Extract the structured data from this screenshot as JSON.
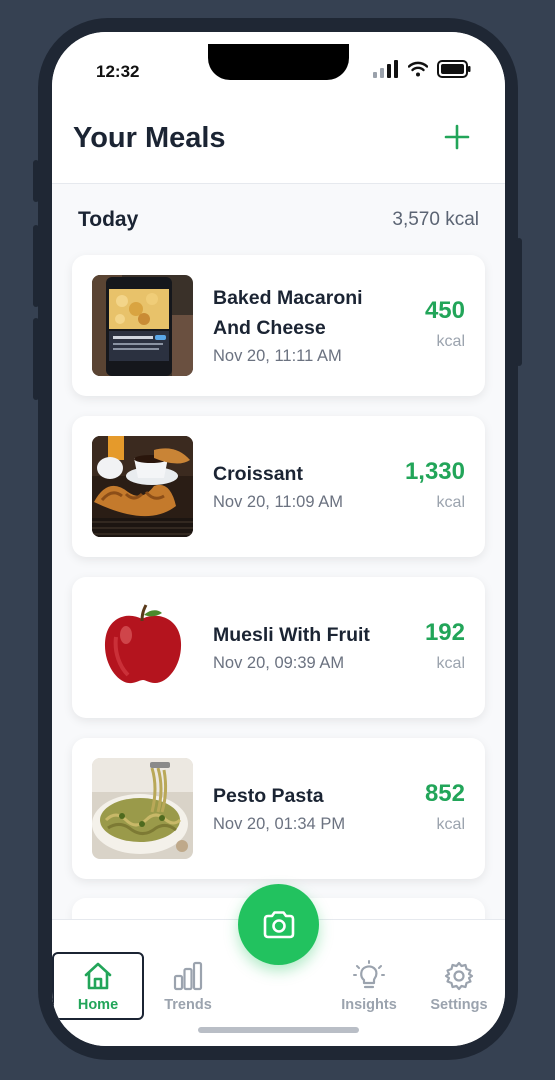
{
  "status_bar": {
    "time": "12:32"
  },
  "header": {
    "title": "Your Meals"
  },
  "section": {
    "title": "Today",
    "total": "3,570 kcal"
  },
  "meals": [
    {
      "name": "Baked Macaroni And Cheese",
      "time": "Nov 20, 11:11 AM",
      "kcal": "450",
      "unit": "kcal",
      "image": "macaroni-photo"
    },
    {
      "name": "Croissant",
      "time": "Nov 20, 11:09 AM",
      "kcal": "1,330",
      "unit": "kcal",
      "image": "croissant-photo"
    },
    {
      "name": "Muesli With Fruit",
      "time": "Nov 20, 09:39 AM",
      "kcal": "192",
      "unit": "kcal",
      "image": "apple-photo"
    },
    {
      "name": "Pesto Pasta",
      "time": "Nov 20, 01:34 PM",
      "kcal": "852",
      "unit": "kcal",
      "image": "pesto-pasta-photo"
    }
  ],
  "tabs": [
    {
      "label": "Home",
      "icon": "home-icon",
      "active": true
    },
    {
      "label": "Trends",
      "icon": "bar-chart-icon",
      "active": false
    },
    {
      "label": "Insights",
      "icon": "lightbulb-icon",
      "active": false
    },
    {
      "label": "Settings",
      "icon": "gear-icon",
      "active": false
    }
  ],
  "colors": {
    "accent": "#22c25f",
    "kcal": "#22a559",
    "background": "#364152"
  }
}
